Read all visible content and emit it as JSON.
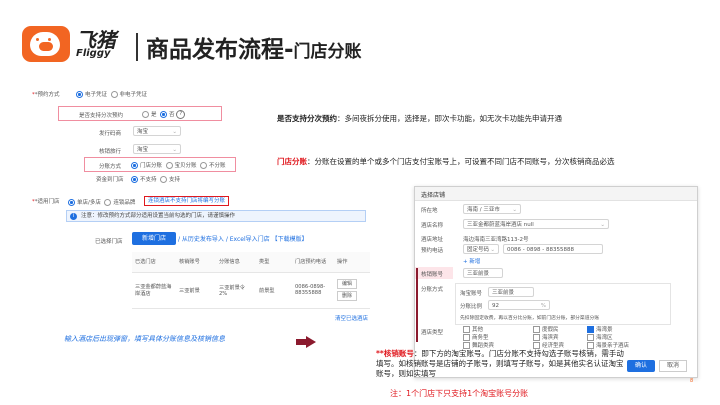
{
  "header": {
    "logo_cn": "飞猪",
    "logo_en": "Fliggy",
    "title_main": "商品发布流程-",
    "title_sub": "门店分账"
  },
  "form": {
    "booking_label": "*预约方式",
    "booking_options": [
      "电子凭证",
      "非电子凭证"
    ],
    "split_label": "是否支持分次预约",
    "split_options": [
      "是",
      "否"
    ],
    "issue_label": "发行码商",
    "issue_value": "淘宝",
    "verify_label": "核销旅行",
    "verify_value": "淘宝",
    "divide_label": "分账方式",
    "divide_options": [
      "门店分账",
      "宝贝分账",
      "不分账"
    ],
    "gift_label": "资金到门店",
    "gift_options": [
      "不支持",
      "支持"
    ],
    "store_label": "*适用门店",
    "store_options": [
      "单店/多店",
      "连锁品牌"
    ],
    "store_link": "连锁酒店不支持门店将编写分账",
    "info_text": "注意：修改预约方式部分适用设置当前勾选的门店，请谨慎操作",
    "selected_label": "已选择门店",
    "add_store_btn": "新增门店",
    "import_links": "/ 从历史发布导入 / Excel导入门店  【下载模版】",
    "table_headers": [
      "已选门店",
      "核销账号",
      "分账信息",
      "类型",
      "门店预约电话",
      "操作"
    ],
    "table_row": {
      "store": "三亚金都蔚蓝海岸酒店",
      "account": "三亚前景",
      "share": "三亚前景令2%",
      "type": "前景型",
      "phone": "0086-0898-88355888",
      "actions": [
        "编辑",
        "删除"
      ]
    },
    "clear_link": "清空已选酒店"
  },
  "annotations": {
    "split_title": "是否支持分次预约",
    "split_text": "：多间夜拆分使用，选择是，即次卡功能，如无次卡功能先申请开通",
    "store_title": "门店分账",
    "store_text": "：分账在设置的单个或多个门店支付宝账号上，可设置不同门店不同账号，分次核销商品必选",
    "popup_hint": "输入酒店后出现弹窗，填写具体分账信息及核销信息",
    "account_prefix": "**",
    "account_title": "核销账号",
    "account_text": "：即下方的淘宝账号。门店分账不支持勾选子账号核销，需手动填写。如核销账号是店铺的子账号，则填写子账号，如是其他实名认证淘宝账号，则如实填写",
    "footnote": "注：1个门店下只支持1个淘宝账号分账"
  },
  "modal": {
    "title": "选择店铺",
    "fields": [
      "所在地",
      "酒店名称",
      "酒店地址",
      "预约电话",
      "核销账号",
      "分账方式",
      "酒店类型"
    ],
    "location": "海南 / 三亚市",
    "hotel_name": "三亚金都蔚蓝海岸酒店 null",
    "address": "海边海南三亚湾路113-2号",
    "phone": "0086 - 0898 - 88355888",
    "phone_prefix": "固定号码",
    "add_link": "+ 新增",
    "account_value": "三亚前景",
    "taobao_label": "淘宝账号",
    "taobao_value": "三亚前景",
    "ratio_label": "分账比例",
    "ratio_value": "92",
    "ratio_unit": "%",
    "ratio_note": "先扣除固定收费，再以百分比分账，如前门店分账，部分渠道分账",
    "types": [
      "其他",
      "度假民",
      "海湾景",
      "商务型",
      "海滨宾",
      "海湾区",
      "舞蹈类宾",
      "经济型宾",
      "海景亲子酒店"
    ],
    "type_checked": [
      false,
      false,
      true,
      false,
      false,
      false,
      false,
      false,
      false
    ],
    "confirm_btn": "确认",
    "cancel_btn": "取消"
  },
  "page_number": "8",
  "colors": {
    "brand": "#f26522",
    "highlight_box": "#f08ea0",
    "annotation_red": "#e0191f",
    "link_blue": "#1e6fe0",
    "arrow": "#8b1a2e"
  }
}
